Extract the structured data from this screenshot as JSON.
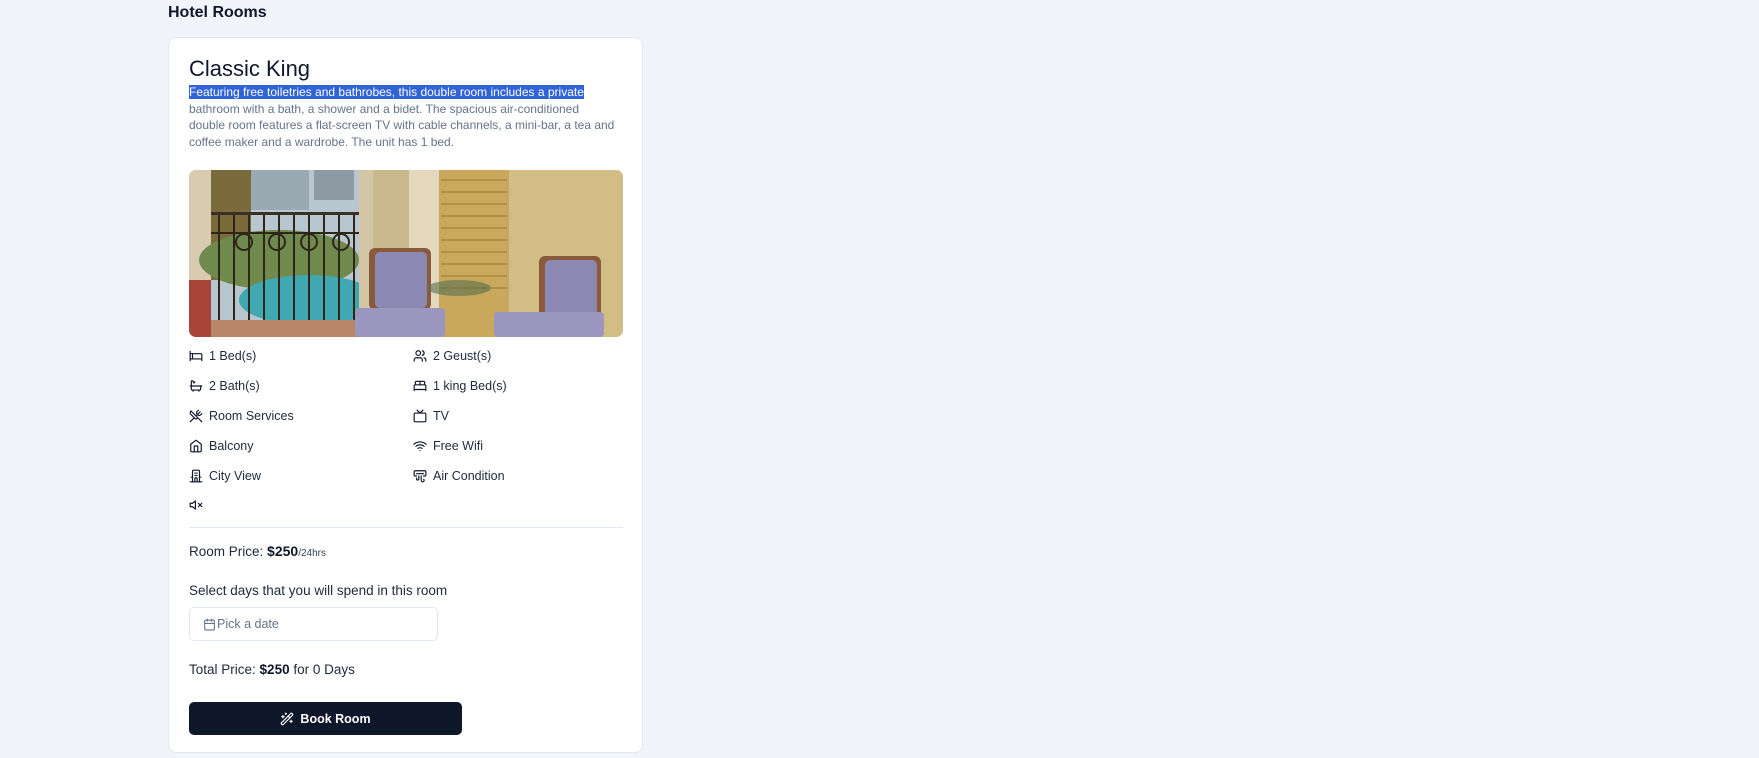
{
  "page": {
    "heading": "Hotel Rooms"
  },
  "room": {
    "title": "Classic King",
    "description_selected": "Featuring free toiletries and bathrobes, this double room includes a private",
    "description_rest": "bathroom with a bath, a shower and a bidet. The spacious air-conditioned double room features a flat-screen TV with cable channels, a mini-bar, a tea and coffee maker and a wardrobe. The unit has 1 bed.",
    "amenities": [
      {
        "icon": "bed-icon",
        "label": "1 Bed(s)"
      },
      {
        "icon": "users-icon",
        "label": "2 Geust(s)"
      },
      {
        "icon": "bath-icon",
        "label": "2 Bath(s)"
      },
      {
        "icon": "bed-double-icon",
        "label": "1 king Bed(s)"
      },
      {
        "icon": "utensils-crossed-icon",
        "label": "Room Services"
      },
      {
        "icon": "tv-icon",
        "label": "TV"
      },
      {
        "icon": "home-icon",
        "label": "Balcony"
      },
      {
        "icon": "wifi-icon",
        "label": "Free Wifi"
      },
      {
        "icon": "hotel-icon",
        "label": "City View"
      },
      {
        "icon": "air-vent-icon",
        "label": "Air Condition"
      },
      {
        "icon": "volume-mute-icon",
        "label": ""
      }
    ],
    "price": {
      "label": "Room Price:",
      "value": "$250",
      "unit": "/24hrs"
    },
    "days_label": "Select days that you will spend in this room",
    "date_picker": {
      "placeholder": "Pick a date"
    },
    "total": {
      "label": "Total Price:",
      "value": "$250",
      "suffix": "for 0 Days"
    },
    "book_button": {
      "label": "Book Room"
    }
  },
  "colors": {
    "background": "#f1f4f9",
    "primary": "#0f172a",
    "muted_text": "#64748b",
    "selection": "#2f63d6",
    "border": "#e2e8f0"
  }
}
